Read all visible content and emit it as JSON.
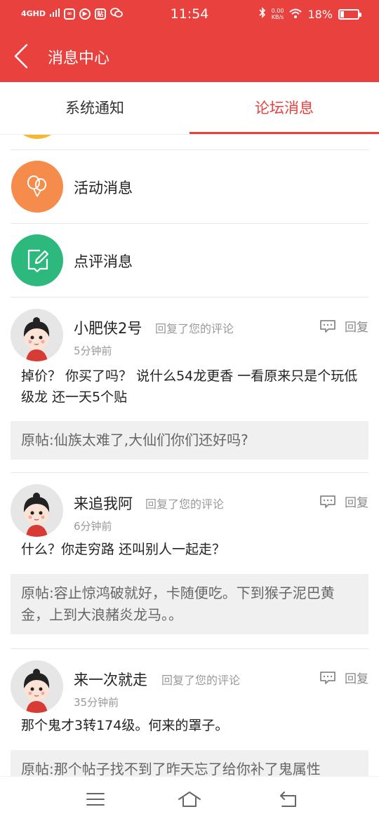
{
  "status_bar": {
    "network": "4GHD",
    "time": "11:54",
    "speed_top": "0.00",
    "speed_bottom": "KB/s",
    "battery": "18%",
    "battery_level": 0.18,
    "icons": [
      "signal-icon",
      "weibo-icon",
      "play-icon",
      "tieba-icon",
      "wechat-icon",
      "bluetooth-icon",
      "wifi-icon",
      "battery-icon"
    ]
  },
  "nav": {
    "title": "消息中心"
  },
  "tabs": [
    {
      "label": "系统通知",
      "active": false
    },
    {
      "label": "论坛消息",
      "active": true
    }
  ],
  "categories": [
    {
      "label": "活动消息",
      "color": "#f58c4c",
      "icon": "balloon-icon"
    },
    {
      "label": "点评消息",
      "color": "#2db87d",
      "icon": "edit-comment-icon"
    }
  ],
  "reply_label": "回复",
  "messages": [
    {
      "user": "小肥侠2号",
      "action": "回复了您的评论",
      "time": "5分钟前",
      "text": "掉价？ 你买了吗？ 说什么54龙更香 一看原来只是个玩低级龙 还一天5个贴",
      "original": "原帖:仙族太难了,大仙们你们还好吗?"
    },
    {
      "user": "来追我阿",
      "action": "回复了您的评论",
      "time": "6分钟前",
      "text": "什么？你走穷路 还叫别人一起走？",
      "original": "原帖:容止惊鸿破就好，卡随便吃。下到猴子泥巴黄金，上到大浪赭炎龙马。。"
    },
    {
      "user": "来一次就走",
      "action": "回复了您的评论",
      "time": "35分钟前",
      "text": "那个鬼才3转174级。何来的罩子。",
      "original": "原帖:那个帖子找不到了昨天忘了给你补了鬼属性"
    }
  ],
  "colors": {
    "brand": "#e8413e",
    "muted": "#999999"
  }
}
